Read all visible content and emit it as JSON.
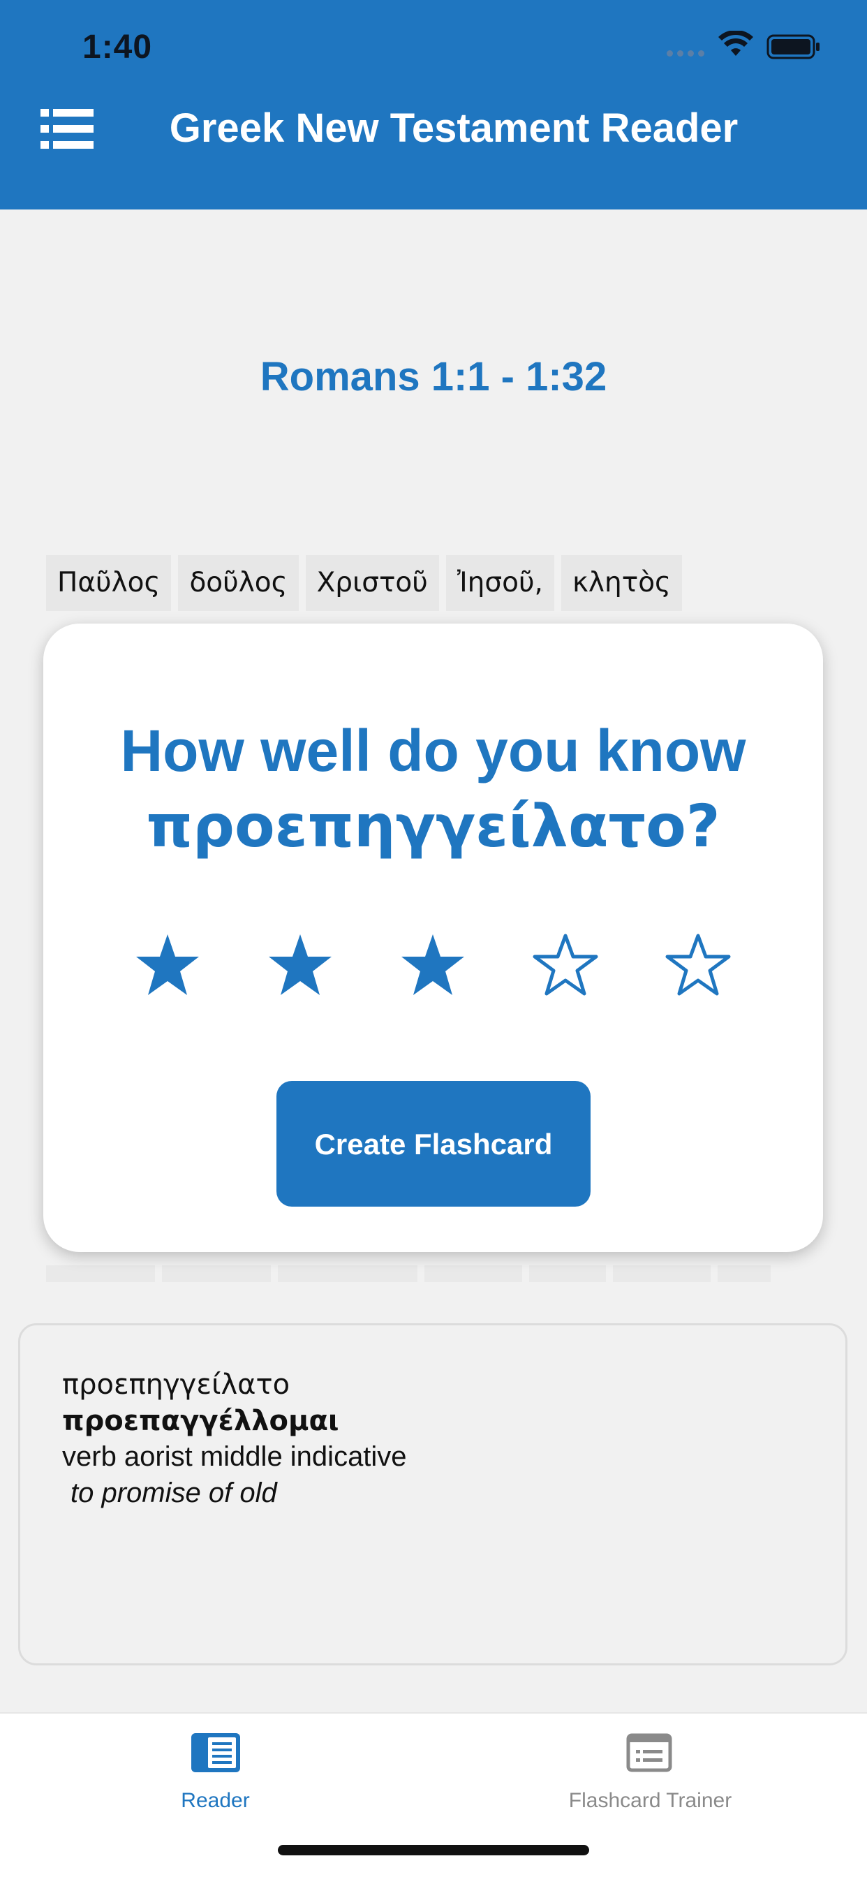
{
  "status_bar": {
    "time": "1:40"
  },
  "header": {
    "title": "Greek New Testament Reader",
    "menu_icon": "list-menu-icon",
    "background": "#1f76c0"
  },
  "passage": {
    "title": "Romans 1:1 - 1:32"
  },
  "words": [
    "Παῦλος",
    "δοῦλος",
    "Χριστοῦ",
    "Ἰησοῦ,",
    "κλητὸς"
  ],
  "rating_card": {
    "question_prefix": "How well do you know",
    "word": "προεπηγγείλατο?",
    "rating": 3,
    "max_rating": 5,
    "create_button_label": "Create Flashcard"
  },
  "word_detail": {
    "form": "προεπηγγείλατο",
    "lemma": "προεπαγγέλλομαι",
    "parsing": "verb aorist middle indicative",
    "gloss": "to promise of old"
  },
  "tabs": [
    {
      "label": "Reader",
      "icon": "book-reader-icon",
      "active": true
    },
    {
      "label": "Flashcard Trainer",
      "icon": "flashcard-icon",
      "active": false
    }
  ],
  "colors": {
    "accent": "#1f76c0",
    "inactive_tab": "#8a8a8a"
  }
}
